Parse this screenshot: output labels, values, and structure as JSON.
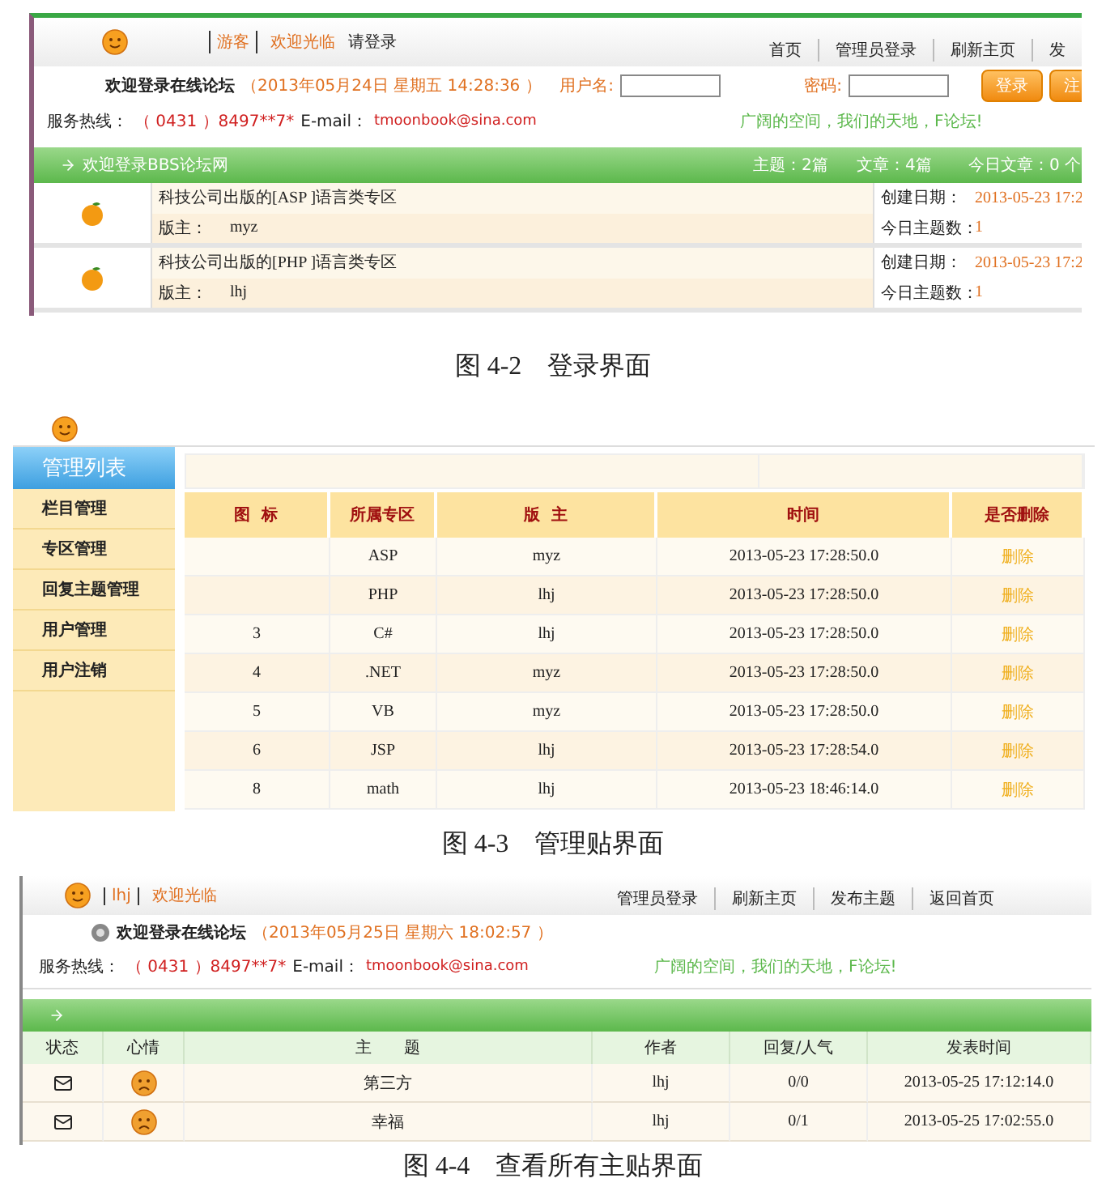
{
  "login_figure": {
    "user_tag": "游客",
    "welcome": "欢迎光临",
    "login_prompt": "请登录",
    "nav": [
      "首页",
      "管理员登录",
      "刷新主页",
      "发"
    ],
    "title": "欢迎登录在线论坛",
    "datetime": "（2013年05月24日 星期五 14:28:36 ）",
    "hotline_label": "服务热线：",
    "hotline": "（ 0431 ）8497**7*",
    "email_label": "E-mail：",
    "email": "tmoonbook@sina.com",
    "username_label": "用户名:",
    "password_label": "密码:",
    "slogan": "广阔的空间，我们的天地，F论坛!",
    "buttons": [
      "登录",
      "注"
    ],
    "bar": {
      "title": "欢迎登录BBS论坛网",
      "topics": "主题：2篇",
      "posts": "文章：4篇",
      "today": "今日文章：0 个"
    },
    "boards": [
      {
        "name": "科技公司出版的[ASP ]语言类专区",
        "moderator_label": "版主：",
        "moderator": "myz",
        "created_label": "创建日期：",
        "created": "2013-05-23 17:2",
        "today_label": "今日主题数：",
        "today": "1"
      },
      {
        "name": "科技公司出版的[PHP ]语言类专区",
        "moderator_label": "版主：",
        "moderator": "lhj",
        "created_label": "创建日期：",
        "created": "2013-05-23 17:2",
        "today_label": "今日主题数：",
        "today": "1"
      }
    ]
  },
  "caption_1": "图 4-2　登录界面",
  "admin_figure": {
    "menu_title": "管理列表",
    "menu": [
      "栏目管理",
      "专区管理",
      "回复主题管理",
      "用户管理",
      "用户注销"
    ],
    "columns": [
      "图  标",
      "所属专区",
      "版  主",
      "时间",
      "是否删除"
    ],
    "rows": [
      {
        "zone": "ASP",
        "moderator": "myz",
        "time": "2013-05-23 17:28:50.0",
        "action": "删除"
      },
      {
        "zone": "PHP",
        "moderator": "lhj",
        "time": "2013-05-23 17:28:50.0",
        "action": "删除"
      },
      {
        "icon": "3",
        "zone": "C#",
        "moderator": "lhj",
        "time": "2013-05-23 17:28:50.0",
        "action": "删除"
      },
      {
        "icon": "4",
        "zone": ".NET",
        "moderator": "myz",
        "time": "2013-05-23 17:28:50.0",
        "action": "删除"
      },
      {
        "icon": "5",
        "zone": "VB",
        "moderator": "myz",
        "time": "2013-05-23 17:28:50.0",
        "action": "删除"
      },
      {
        "icon": "6",
        "zone": "JSP",
        "moderator": "lhj",
        "time": "2013-05-23 17:28:54.0",
        "action": "删除"
      },
      {
        "icon": "8",
        "zone": "math",
        "moderator": "lhj",
        "time": "2013-05-23 18:46:14.0",
        "action": "删除"
      }
    ]
  },
  "caption_2": "图 4-3　管理贴界面",
  "posts_figure": {
    "user_tag": "lhj",
    "welcome": "欢迎光临",
    "nav": [
      "管理员登录",
      "刷新主页",
      "发布主题",
      "返回首页"
    ],
    "title": "欢迎登录在线论坛",
    "datetime": "（2013年05月25日 星期六 18:02:57 ）",
    "hotline_label": "服务热线：",
    "hotline": "（ 0431 ）8497**7*",
    "email_label": "E-mail：",
    "email": "tmoonbook@sina.com",
    "slogan": "广阔的空间，我们的天地，F论坛!",
    "columns": [
      "状态",
      "心情",
      "主　　题",
      "作者",
      "回复/人气",
      "发表时间"
    ],
    "rows": [
      {
        "topic": "第三方",
        "author": "lhj",
        "replies": "0/0",
        "time": "2013-05-25 17:12:14.0"
      },
      {
        "topic": "幸福",
        "author": "lhj",
        "replies": "0/1",
        "time": "2013-05-25 17:02:55.0"
      }
    ]
  },
  "caption_3": "图 4-4　查看所有主贴界面"
}
